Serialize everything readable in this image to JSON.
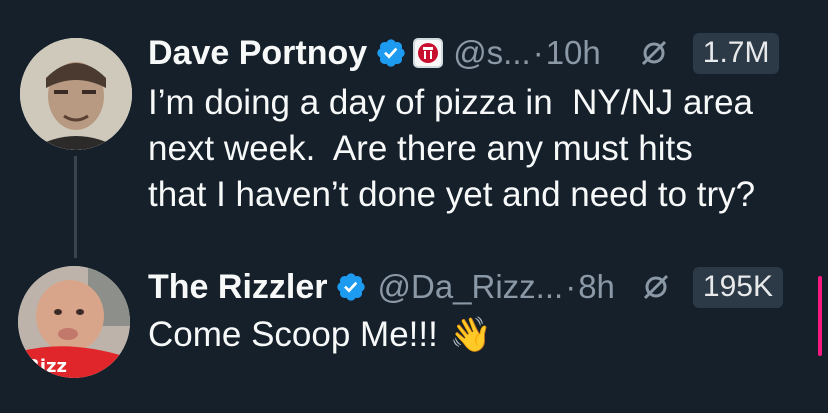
{
  "tweets": [
    {
      "name": "Dave Portnoy",
      "handle": "@s...",
      "separator": "·",
      "time": "10h",
      "views": "1.7M",
      "text_lines": [
        "I’m doing a day of pizza in  NY/NJ area",
        "next week.  Are there any must hits",
        "that I haven’t done yet and need to try?"
      ]
    },
    {
      "name": "The Rizzler",
      "handle": "@Da_Rizz...",
      "separator": "·",
      "time": "8h",
      "views": "195K",
      "text": "Come Scoop Me!!!",
      "emoji": "👋"
    }
  ],
  "colors": {
    "background": "#15202b",
    "verified": "#1d9bf0",
    "secondary_text": "#8b98a5",
    "thread_line": "#38444d",
    "scroll_accent": "#f91880"
  },
  "icons": {
    "verified": "verified-badge-icon",
    "affiliate": "barstool-affiliate-icon",
    "grok": "grok-icon"
  }
}
